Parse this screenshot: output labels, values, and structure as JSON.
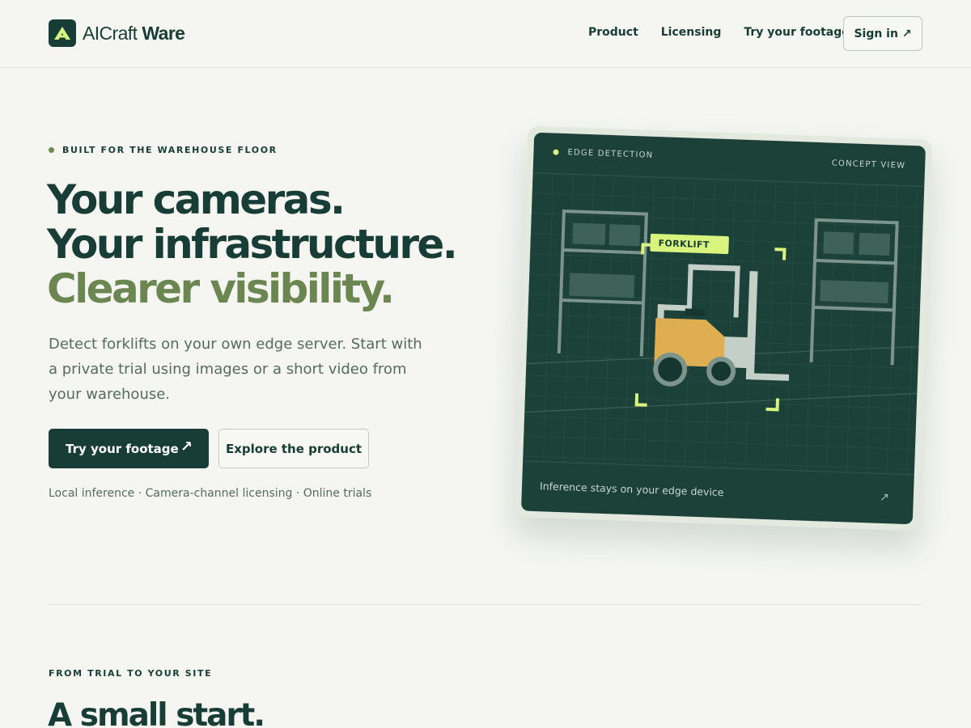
{
  "brand": {
    "name_light": "AICraft",
    "name_bold": "Ware",
    "logo_icon": "a-letter-logo-icon",
    "colors": {
      "primary": "#183d36",
      "accent": "#d8f47f",
      "olive": "#6b8650",
      "background": "#f5f6f1"
    }
  },
  "nav": {
    "items": [
      {
        "label": "Product"
      },
      {
        "label": "Licensing"
      },
      {
        "label": "Try your footage"
      }
    ],
    "signin_label": "Sign in ↗"
  },
  "hero": {
    "eyebrow": "BUILT FOR THE WAREHOUSE FLOOR",
    "headline_1": "Your cameras.",
    "headline_2": "Your infrastructure.",
    "headline_3": "Clearer visibility.",
    "lede": "Detect forklifts on your own edge server. Start with a private trial using images or a short video from your warehouse.",
    "primary_button": "Try your footage",
    "primary_arrow": "↗",
    "secondary_button": "Explore the product",
    "features": "Local inference · Camera-channel licensing · Online trials"
  },
  "card": {
    "status": "EDGE DETECTION",
    "view": "CONCEPT VIEW",
    "detection_label": "FORKLIFT",
    "caption": "Inference stays on your edge device",
    "caption_arrow": "↗"
  },
  "section": {
    "eyebrow": "FROM TRIAL TO YOUR SITE",
    "title": "A small start."
  }
}
